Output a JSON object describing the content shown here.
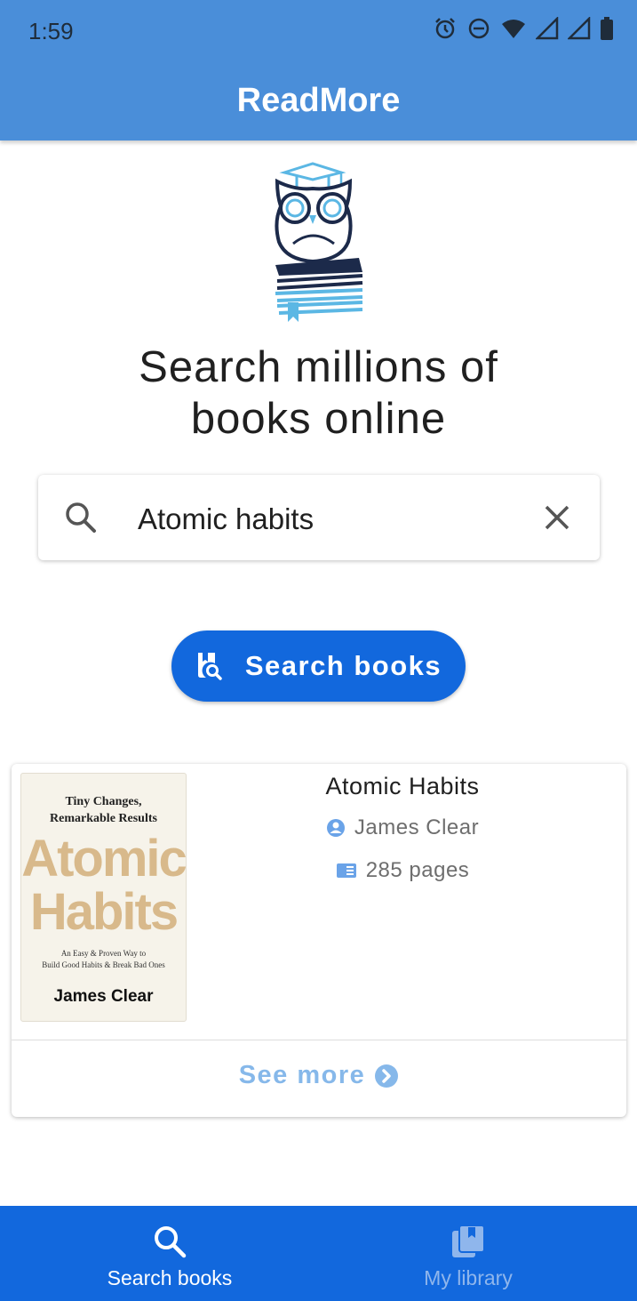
{
  "status_bar": {
    "time": "1:59",
    "icons": [
      "alarm-icon",
      "do-not-disturb-icon",
      "wifi-icon",
      "signal-icon",
      "signal-icon",
      "battery-icon"
    ]
  },
  "app_bar": {
    "title": "ReadMore"
  },
  "hero": {
    "logo_icon": "owl-on-books-icon",
    "headline_line1": "Search millions of",
    "headline_line2": "books online"
  },
  "search": {
    "value": "Atomic habits",
    "placeholder": "",
    "search_icon": "search-icon",
    "clear_icon": "close-icon"
  },
  "search_button": {
    "label": "Search books",
    "icon": "book-search-icon"
  },
  "result": {
    "title": "Atomic Habits",
    "author": "James Clear",
    "pages": "285 pages",
    "cover": {
      "subtitle_line1": "Tiny Changes,",
      "subtitle_line2": "Remarkable Results",
      "word1": "Atomic",
      "word2": "Habits",
      "tagline_line1": "An Easy & Proven Way to",
      "tagline_line2": "Build Good Habits & Break Bad Ones",
      "author": "James Clear"
    },
    "see_more": "See more"
  },
  "bottom_nav": {
    "items": [
      {
        "label": "Search books",
        "icon": "search-icon",
        "active": true
      },
      {
        "label": "My library",
        "icon": "library-icon",
        "active": false
      }
    ]
  },
  "colors": {
    "app_bar": "#4a8ed9",
    "primary": "#1268dd",
    "see_more": "#86b8ea",
    "meta_icon": "#6aa3e8"
  }
}
